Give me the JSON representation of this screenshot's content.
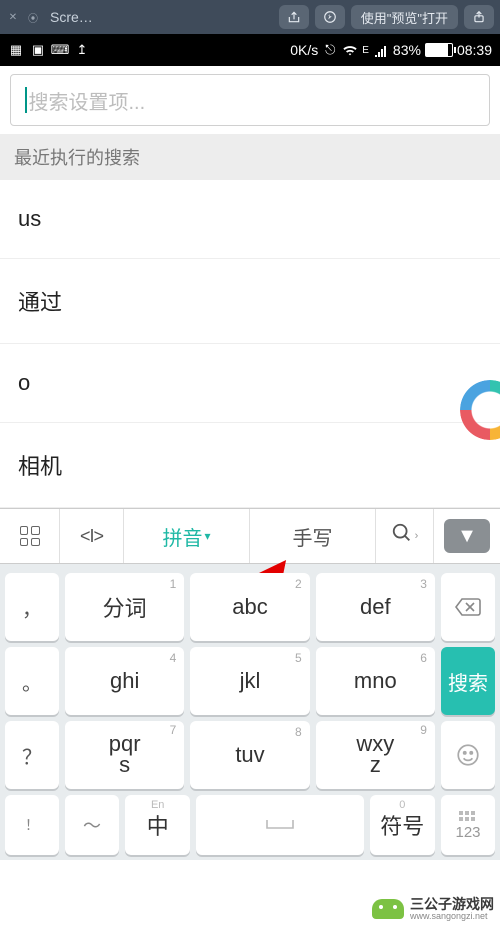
{
  "macbar": {
    "title": "Scre…",
    "open_with_button": "使用\"预览\"打开"
  },
  "statusbar": {
    "speed": "0K/s",
    "signal_label": "E",
    "battery_pct": "83%",
    "time": "08:39"
  },
  "search": {
    "placeholder": "搜索设置项..."
  },
  "section_header": "最近执行的搜索",
  "recent": [
    "us",
    "通过",
    "o",
    "相机"
  ],
  "kbd_toolbar": {
    "input_mode_pinyin": "拼音",
    "input_mode_handwrite": "手写"
  },
  "keyboard": {
    "rows": [
      {
        "side": "，",
        "keys": [
          {
            "num": "1",
            "label": "分词"
          },
          {
            "num": "2",
            "label": "abc"
          },
          {
            "num": "3",
            "label": "def"
          }
        ],
        "right": {
          "type": "backspace"
        }
      },
      {
        "side": "。",
        "keys": [
          {
            "num": "4",
            "label": "ghi"
          },
          {
            "num": "5",
            "label": "jkl"
          },
          {
            "num": "6",
            "label": "mno"
          }
        ],
        "right": {
          "type": "search",
          "label": "搜索"
        }
      },
      {
        "side": "？",
        "keys": [
          {
            "num": "7",
            "label": "pqr\ns"
          },
          {
            "num": "8",
            "label": "tuv"
          },
          {
            "num": "9",
            "label": "wxy\nz"
          }
        ],
        "right": {
          "type": "emoji"
        }
      },
      {
        "side": "！",
        "bottom": true,
        "keys_bottom": {
          "lang_sub": "En",
          "lang": "中",
          "space": "",
          "num0": "0",
          "sym": "符号"
        },
        "right": {
          "type": "numswitch",
          "label": "123"
        }
      }
    ]
  },
  "watermark": {
    "name": "三公子游戏网",
    "url": "www.sangongzi.net"
  }
}
